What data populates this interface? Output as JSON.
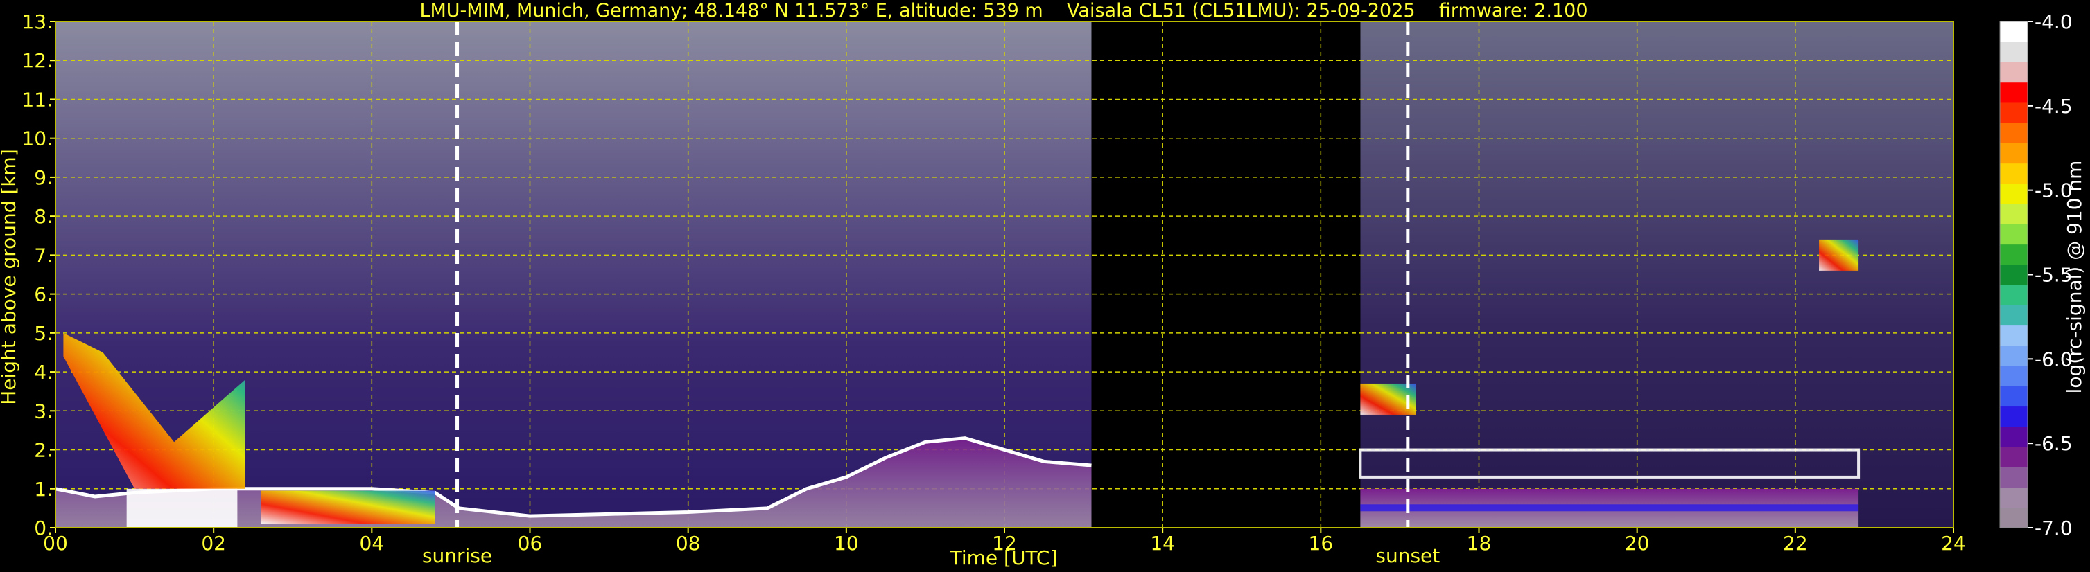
{
  "chart_data": {
    "type": "heatmap",
    "title": "LMU-MIM, Munich, Germany; 48.148° N 11.573° E, altitude: 539 m    Vaisala CL51 (CL51LMU): 25-09-2025    firmware: 2.100",
    "xlabel": "Time [UTC]",
    "ylabel": "Height above ground [km]",
    "xlim": [
      0,
      24
    ],
    "ylim": [
      0,
      13
    ],
    "x_ticks": [
      "00",
      "02",
      "04",
      "06",
      "08",
      "10",
      "12",
      "14",
      "16",
      "18",
      "20",
      "22",
      "24"
    ],
    "y_ticks": [
      "0.",
      "1.",
      "2.",
      "3.",
      "4.",
      "5.",
      "6.",
      "7.",
      "8.",
      "9.",
      "10.",
      "11.",
      "12.",
      "13."
    ],
    "grid": true,
    "data_gap_hours": [
      13.1,
      16.5
    ],
    "markers": [
      {
        "label": "sunrise",
        "time": 5.08
      },
      {
        "label": "sunset",
        "time": 17.1
      }
    ],
    "colorbar": {
      "label": "log(rc-signal) @ 910 nm",
      "range": [
        -7.0,
        -4.0
      ],
      "ticks": [
        "-7.0",
        "-6.5",
        "-6.0",
        "-5.5",
        "-5.0",
        "-4.5",
        "-4.0"
      ],
      "colors": [
        "#9a8a9c",
        "#a08aa8",
        "#8a5a9c",
        "#7a1f8e",
        "#5a0aa0",
        "#2a1ae6",
        "#3a56f0",
        "#5a84f4",
        "#7aa6f6",
        "#98c4f8",
        "#40b8b0",
        "#30c080",
        "#109030",
        "#30b030",
        "#88e040",
        "#c8f040",
        "#f0f000",
        "#ffd000",
        "#ffa000",
        "#ff7000",
        "#ff3000",
        "#ff0000",
        "#e8b8b8",
        "#e0e0e0",
        "#ffffff"
      ]
    },
    "boundary_layer_km": [
      {
        "t": 0.0,
        "h": 1.0
      },
      {
        "t": 0.5,
        "h": 0.8
      },
      {
        "t": 1.0,
        "h": 0.9
      },
      {
        "t": 2.0,
        "h": 1.0
      },
      {
        "t": 3.0,
        "h": 1.0
      },
      {
        "t": 4.0,
        "h": 1.0
      },
      {
        "t": 4.8,
        "h": 0.9
      },
      {
        "t": 5.1,
        "h": 0.5
      },
      {
        "t": 6.0,
        "h": 0.3
      },
      {
        "t": 7.0,
        "h": 0.35
      },
      {
        "t": 8.0,
        "h": 0.4
      },
      {
        "t": 9.0,
        "h": 0.5
      },
      {
        "t": 9.5,
        "h": 1.0
      },
      {
        "t": 10.0,
        "h": 1.3
      },
      {
        "t": 10.5,
        "h": 1.8
      },
      {
        "t": 11.0,
        "h": 2.2
      },
      {
        "t": 11.5,
        "h": 2.3
      },
      {
        "t": 12.0,
        "h": 2.0
      },
      {
        "t": 12.5,
        "h": 1.7
      },
      {
        "t": 13.1,
        "h": 1.6
      }
    ],
    "cloud_layers": [
      {
        "t0": 0.1,
        "t1": 2.4,
        "h0": 1.0,
        "h1": 5.0,
        "note": "sloping layer"
      },
      {
        "t0": 16.5,
        "t1": 17.2,
        "h0": 2.9,
        "h1": 3.7
      },
      {
        "t0": 22.3,
        "t1": 22.8,
        "h0": 6.6,
        "h1": 7.4
      },
      {
        "t0": 16.5,
        "t1": 22.8,
        "h0": 1.3,
        "h1": 2.0
      }
    ]
  }
}
